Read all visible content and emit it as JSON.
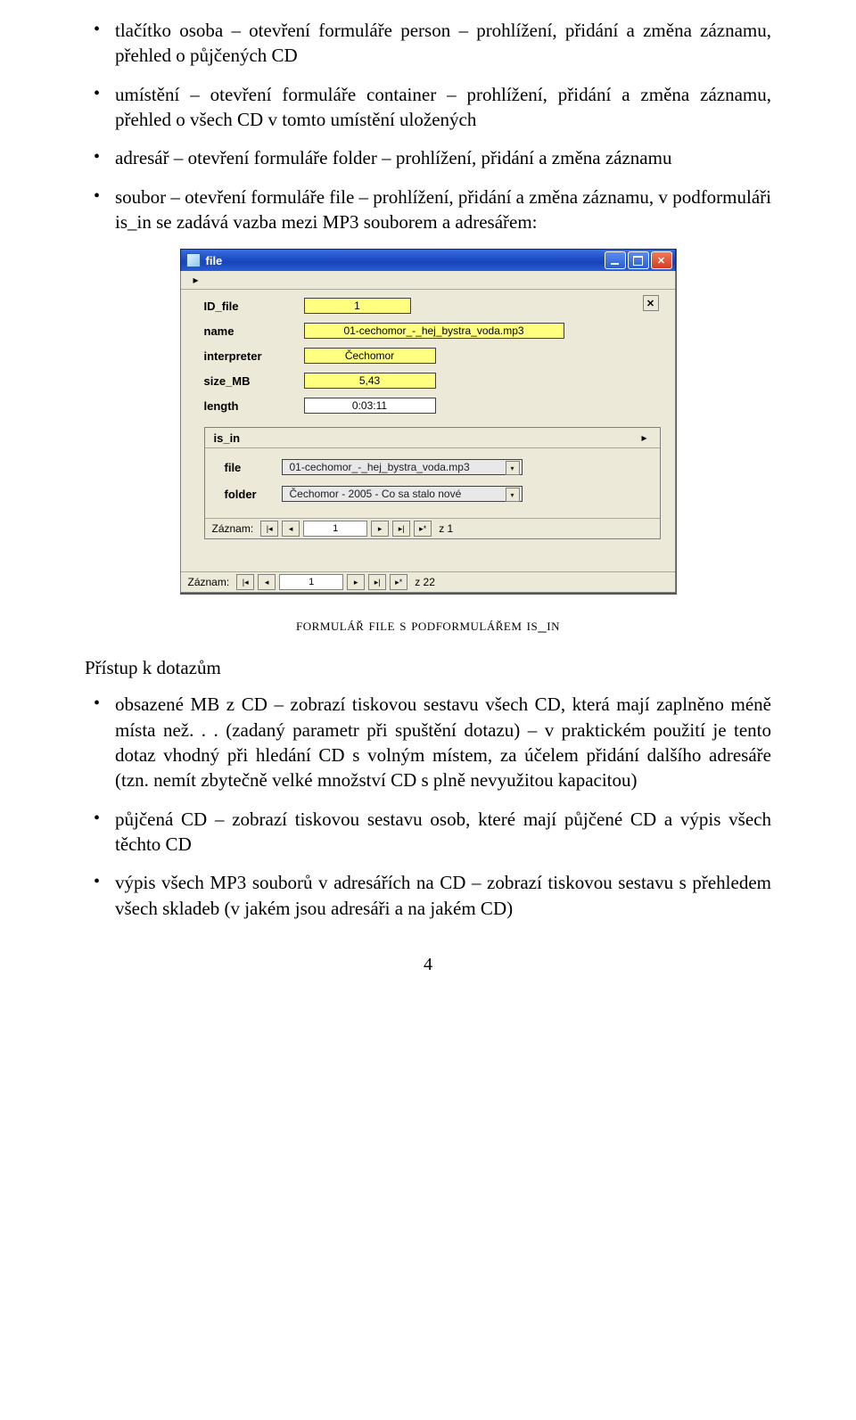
{
  "list1": {
    "i0": "tlačítko osoba – otevření formuláře person – prohlížení, přidání a změna záznamu, přehled o půjčených CD",
    "i1": "umístění – otevření formuláře container – prohlížení, přidání a změna záznamu, přehled o všech CD v tomto umístění uložených",
    "i2": "adresář – otevření formuláře folder – prohlížení, přidání a změna záznamu",
    "i3": "soubor – otevření formuláře file – prohlížení, přidání a změna záznamu, v podformuláři is_in se zadává vazba mezi MP3 souborem a adresářem:"
  },
  "window": {
    "title": "file",
    "fields": {
      "id_file": {
        "label": "ID_file",
        "value": "1"
      },
      "name": {
        "label": "name",
        "value": "01-cechomor_-_hej_bystra_voda.mp3"
      },
      "interpreter": {
        "label": "interpreter",
        "value": "Čechomor"
      },
      "size_mb": {
        "label": "size_MB",
        "value": "5,43"
      },
      "length": {
        "label": "length",
        "value": "0:03:11"
      }
    },
    "subform": {
      "title": "is_in",
      "file": {
        "label": "file",
        "value": "01-cechomor_-_hej_bystra_voda.mp3"
      },
      "folder": {
        "label": "folder",
        "value": "Čechomor - 2005 - Co sa stalo nové"
      },
      "nav": {
        "label": "Záznam:",
        "pos": "1",
        "count": "z  1"
      }
    },
    "nav": {
      "label": "Záznam:",
      "pos": "1",
      "count": "z  22"
    }
  },
  "caption": "formulář file s podformulářem is_in",
  "section": "Přístup k dotazům",
  "list2": {
    "i0": "obsazené MB z CD – zobrazí tiskovou sestavu všech CD, která mají zaplněno méně místa než. . . (zadaný parametr při spuštění dotazu) – v praktickém použití je tento dotaz vhodný při hledání CD s volným místem, za účelem přidání dalšího adresáře (tzn. nemít zbytečně velké množství CD s plně nevyužitou kapacitou)",
    "i1": "půjčená CD – zobrazí tiskovou sestavu osob, které mají půjčené CD a výpis všech těchto CD",
    "i2": "výpis všech MP3 souborů v adresářích na CD – zobrazí tiskovou sestavu s přehledem všech skladeb (v jakém jsou adresáři a na jakém CD)"
  },
  "page_number": "4"
}
